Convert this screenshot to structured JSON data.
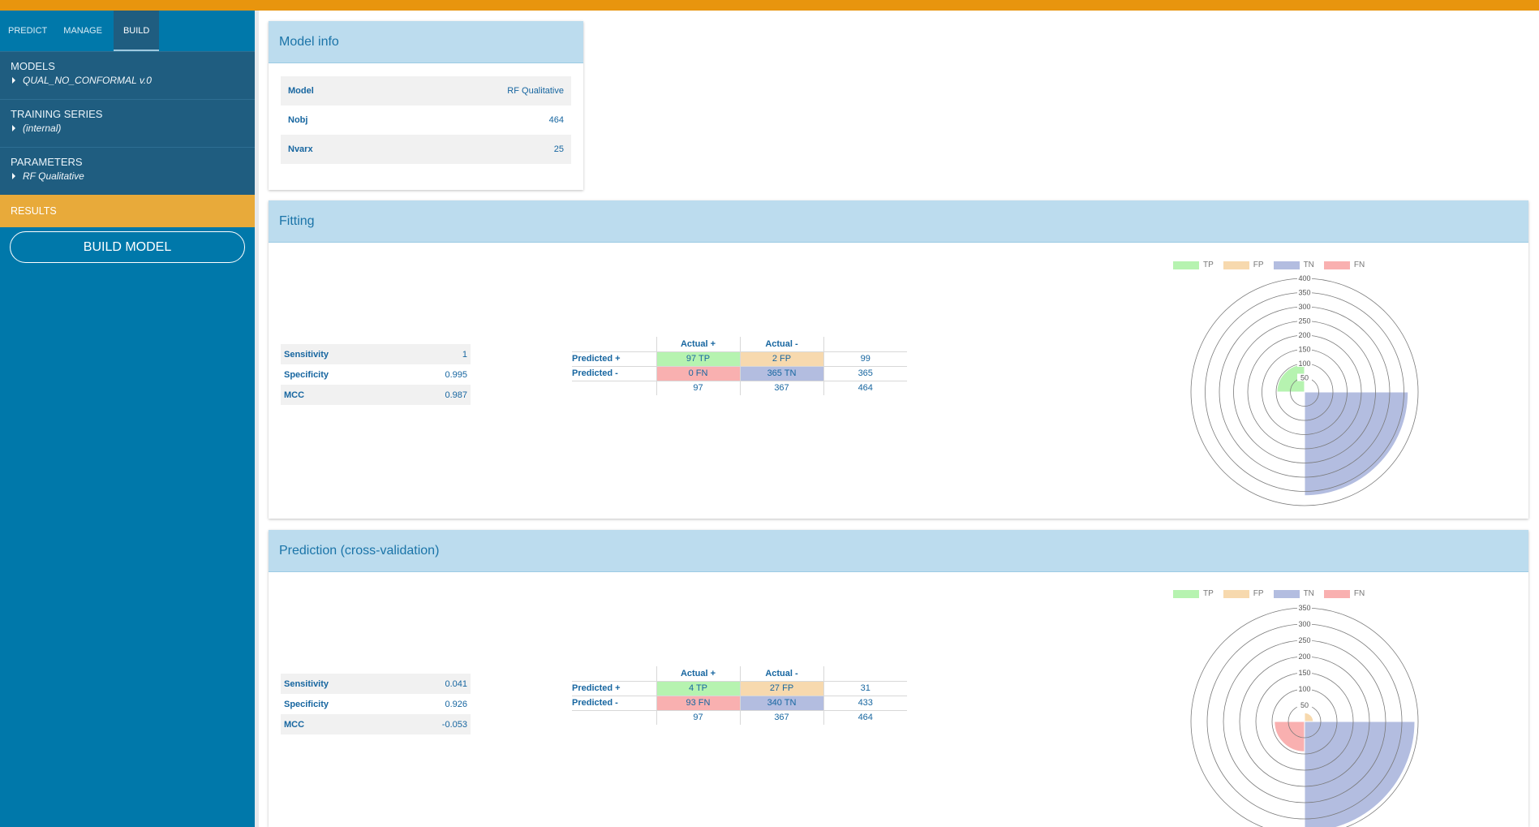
{
  "nav": {
    "tabs": [
      "PREDICT",
      "MANAGE",
      "BUILD"
    ],
    "active": "BUILD"
  },
  "sidebar": {
    "models": {
      "heading": "MODELS",
      "value": "QUAL_NO_CONFORMAL v.0"
    },
    "training": {
      "heading": "TRAINING SERIES",
      "value": "(internal)"
    },
    "parameters": {
      "heading": "PARAMETERS",
      "value": "RF Qualitative"
    },
    "results": "RESULTS",
    "build_button": "BUILD MODEL"
  },
  "colors": {
    "accent": "#e8950e",
    "sidebar": "#0078aa",
    "tp": "#b6f3b0",
    "fp": "#f7d9ae",
    "tn": "#b3bde0",
    "fn": "#f9b0b0"
  },
  "model_info": {
    "title": "Model info",
    "rows": [
      {
        "key": "Model",
        "value": "RF Qualitative"
      },
      {
        "key": "Nobj",
        "value": "464"
      },
      {
        "key": "Nvarx",
        "value": "25"
      }
    ]
  },
  "fitting": {
    "title": "Fitting",
    "metrics": [
      {
        "key": "Sensitivity",
        "value": "1"
      },
      {
        "key": "Specificity",
        "value": "0.995"
      },
      {
        "key": "MCC",
        "value": "0.987"
      }
    ],
    "matrix": {
      "headers": [
        "Actual +",
        "Actual -"
      ],
      "row_labels": [
        "Predicted +",
        "Predicted -"
      ],
      "cells": [
        [
          "97 TP",
          "2 FP",
          "99"
        ],
        [
          "0 FN",
          "365 TN",
          "365"
        ]
      ],
      "totals": [
        "97",
        "367",
        "464"
      ]
    }
  },
  "prediction": {
    "title": "Prediction (cross-validation)",
    "metrics": [
      {
        "key": "Sensitivity",
        "value": "0.041"
      },
      {
        "key": "Specificity",
        "value": "0.926"
      },
      {
        "key": "MCC",
        "value": "-0.053"
      }
    ],
    "matrix": {
      "headers": [
        "Actual +",
        "Actual -"
      ],
      "row_labels": [
        "Predicted +",
        "Predicted -"
      ],
      "cells": [
        [
          "4 TP",
          "27 FP",
          "31"
        ],
        [
          "93 FN",
          "340 TN",
          "433"
        ]
      ],
      "totals": [
        "97",
        "367",
        "464"
      ]
    }
  },
  "chart_data": [
    {
      "type": "polar-area",
      "categories": [
        "TP",
        "FP",
        "TN",
        "FN"
      ],
      "values": [
        97,
        2,
        365,
        0
      ],
      "rlim": [
        0,
        400
      ],
      "ticks": [
        50,
        100,
        150,
        200,
        250,
        300,
        350,
        400
      ],
      "legend": "top"
    },
    {
      "type": "polar-area",
      "categories": [
        "TP",
        "FP",
        "TN",
        "FN"
      ],
      "values": [
        4,
        27,
        340,
        93
      ],
      "rlim": [
        0,
        350
      ],
      "ticks": [
        50,
        100,
        150,
        200,
        250,
        300,
        350
      ],
      "legend": "top"
    }
  ]
}
